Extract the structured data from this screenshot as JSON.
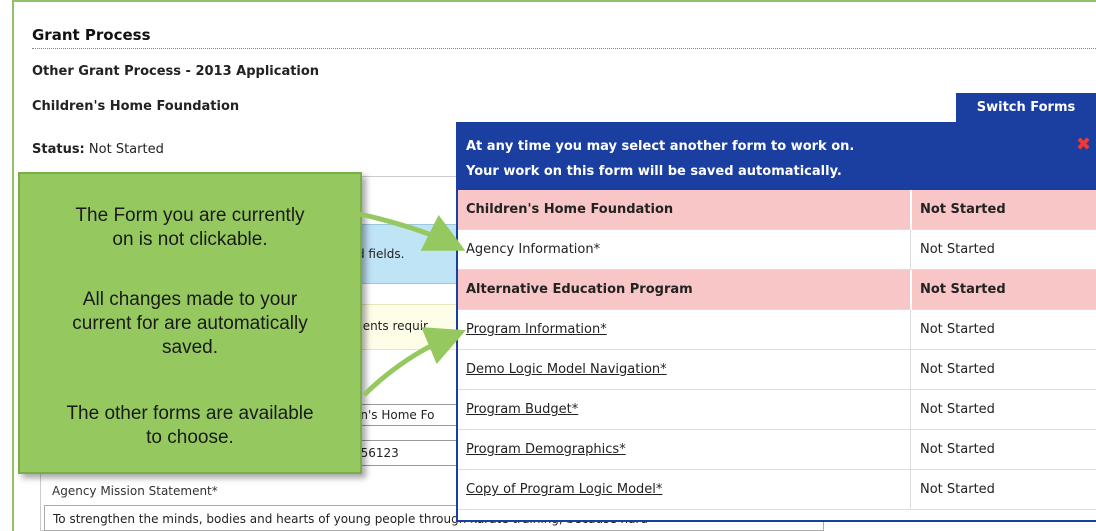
{
  "header": {
    "page_title": "Grant Process",
    "sub_title": "Other Grant Process - 2013 Application",
    "org_title": "Children's Home Foundation",
    "status_label": "Status:",
    "status_value": "Not Started"
  },
  "background_form": {
    "info_text": "d fields.",
    "note_text": "ments requir",
    "field1_value": "en's Home Fo",
    "field2_value": "456123",
    "mission_label": "Agency Mission Statement*",
    "mission_text": "To strengthen the minds, bodies and hearts of young people through karate training, because hard"
  },
  "switch_forms": {
    "tab_label": "Switch Forms",
    "message_line1": "At any time you may select another form to work on.",
    "message_line2": "Your work on this form will be saved automatically.",
    "close_icon": "close-icon",
    "rows": [
      {
        "type": "group",
        "name": "Children's Home Foundation",
        "status": "Not Started"
      },
      {
        "type": "current",
        "name": "Agency Information*",
        "status": "Not Started"
      },
      {
        "type": "group",
        "name": "Alternative Education Program",
        "status": "Not Started"
      },
      {
        "type": "link",
        "name": "Program Information*",
        "status": "Not Started"
      },
      {
        "type": "link",
        "name": "Demo Logic Model Navigation*",
        "status": "Not Started"
      },
      {
        "type": "link",
        "name": "Program Budget*",
        "status": "Not Started"
      },
      {
        "type": "link",
        "name": "Program Demographics*",
        "status": "Not Started"
      },
      {
        "type": "link",
        "name": "Copy of Program Logic Model*",
        "status": "Not Started"
      }
    ]
  },
  "callout": {
    "p1_line1": "The Form you are currently",
    "p1_line2": "on is not clickable.",
    "p2_line1": "All changes made to your",
    "p2_line2": "current for are automatically",
    "p2_line3": "saved.",
    "p3_line1": "The other forms are available",
    "p3_line2": "to choose."
  },
  "colors": {
    "accent_blue": "#1b3fa0",
    "group_row_pink": "#f8c6c6",
    "callout_green": "#95c95f",
    "close_red": "#e83c3c"
  }
}
